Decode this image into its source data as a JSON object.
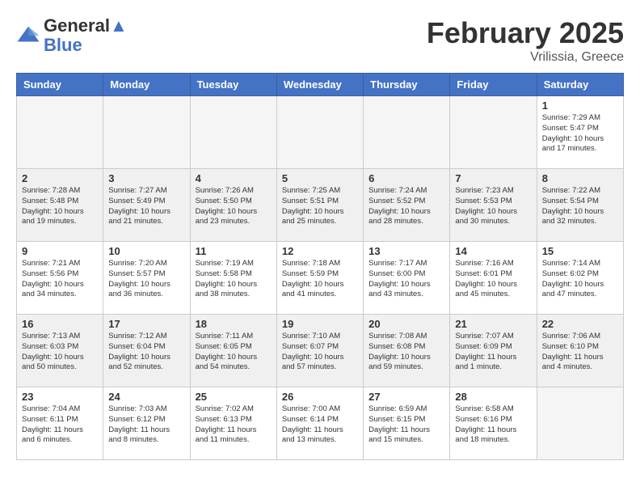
{
  "header": {
    "logo_line1": "General",
    "logo_line2": "Blue",
    "month_title": "February 2025",
    "location": "Vrilissia, Greece"
  },
  "weekdays": [
    "Sunday",
    "Monday",
    "Tuesday",
    "Wednesday",
    "Thursday",
    "Friday",
    "Saturday"
  ],
  "weeks": [
    [
      {
        "day": "",
        "empty": true
      },
      {
        "day": "",
        "empty": true
      },
      {
        "day": "",
        "empty": true
      },
      {
        "day": "",
        "empty": true
      },
      {
        "day": "",
        "empty": true
      },
      {
        "day": "",
        "empty": true
      },
      {
        "day": "1",
        "sunrise": "7:29 AM",
        "sunset": "5:47 PM",
        "daylight": "10 hours and 17 minutes."
      }
    ],
    [
      {
        "day": "2",
        "sunrise": "7:28 AM",
        "sunset": "5:48 PM",
        "daylight": "10 hours and 19 minutes."
      },
      {
        "day": "3",
        "sunrise": "7:27 AM",
        "sunset": "5:49 PM",
        "daylight": "10 hours and 21 minutes."
      },
      {
        "day": "4",
        "sunrise": "7:26 AM",
        "sunset": "5:50 PM",
        "daylight": "10 hours and 23 minutes."
      },
      {
        "day": "5",
        "sunrise": "7:25 AM",
        "sunset": "5:51 PM",
        "daylight": "10 hours and 25 minutes."
      },
      {
        "day": "6",
        "sunrise": "7:24 AM",
        "sunset": "5:52 PM",
        "daylight": "10 hours and 28 minutes."
      },
      {
        "day": "7",
        "sunrise": "7:23 AM",
        "sunset": "5:53 PM",
        "daylight": "10 hours and 30 minutes."
      },
      {
        "day": "8",
        "sunrise": "7:22 AM",
        "sunset": "5:54 PM",
        "daylight": "10 hours and 32 minutes."
      }
    ],
    [
      {
        "day": "9",
        "sunrise": "7:21 AM",
        "sunset": "5:56 PM",
        "daylight": "10 hours and 34 minutes."
      },
      {
        "day": "10",
        "sunrise": "7:20 AM",
        "sunset": "5:57 PM",
        "daylight": "10 hours and 36 minutes."
      },
      {
        "day": "11",
        "sunrise": "7:19 AM",
        "sunset": "5:58 PM",
        "daylight": "10 hours and 38 minutes."
      },
      {
        "day": "12",
        "sunrise": "7:18 AM",
        "sunset": "5:59 PM",
        "daylight": "10 hours and 41 minutes."
      },
      {
        "day": "13",
        "sunrise": "7:17 AM",
        "sunset": "6:00 PM",
        "daylight": "10 hours and 43 minutes."
      },
      {
        "day": "14",
        "sunrise": "7:16 AM",
        "sunset": "6:01 PM",
        "daylight": "10 hours and 45 minutes."
      },
      {
        "day": "15",
        "sunrise": "7:14 AM",
        "sunset": "6:02 PM",
        "daylight": "10 hours and 47 minutes."
      }
    ],
    [
      {
        "day": "16",
        "sunrise": "7:13 AM",
        "sunset": "6:03 PM",
        "daylight": "10 hours and 50 minutes."
      },
      {
        "day": "17",
        "sunrise": "7:12 AM",
        "sunset": "6:04 PM",
        "daylight": "10 hours and 52 minutes."
      },
      {
        "day": "18",
        "sunrise": "7:11 AM",
        "sunset": "6:05 PM",
        "daylight": "10 hours and 54 minutes."
      },
      {
        "day": "19",
        "sunrise": "7:10 AM",
        "sunset": "6:07 PM",
        "daylight": "10 hours and 57 minutes."
      },
      {
        "day": "20",
        "sunrise": "7:08 AM",
        "sunset": "6:08 PM",
        "daylight": "10 hours and 59 minutes."
      },
      {
        "day": "21",
        "sunrise": "7:07 AM",
        "sunset": "6:09 PM",
        "daylight": "11 hours and 1 minute."
      },
      {
        "day": "22",
        "sunrise": "7:06 AM",
        "sunset": "6:10 PM",
        "daylight": "11 hours and 4 minutes."
      }
    ],
    [
      {
        "day": "23",
        "sunrise": "7:04 AM",
        "sunset": "6:11 PM",
        "daylight": "11 hours and 6 minutes."
      },
      {
        "day": "24",
        "sunrise": "7:03 AM",
        "sunset": "6:12 PM",
        "daylight": "11 hours and 8 minutes."
      },
      {
        "day": "25",
        "sunrise": "7:02 AM",
        "sunset": "6:13 PM",
        "daylight": "11 hours and 11 minutes."
      },
      {
        "day": "26",
        "sunrise": "7:00 AM",
        "sunset": "6:14 PM",
        "daylight": "11 hours and 13 minutes."
      },
      {
        "day": "27",
        "sunrise": "6:59 AM",
        "sunset": "6:15 PM",
        "daylight": "11 hours and 15 minutes."
      },
      {
        "day": "28",
        "sunrise": "6:58 AM",
        "sunset": "6:16 PM",
        "daylight": "11 hours and 18 minutes."
      },
      {
        "day": "",
        "empty": true
      }
    ]
  ]
}
